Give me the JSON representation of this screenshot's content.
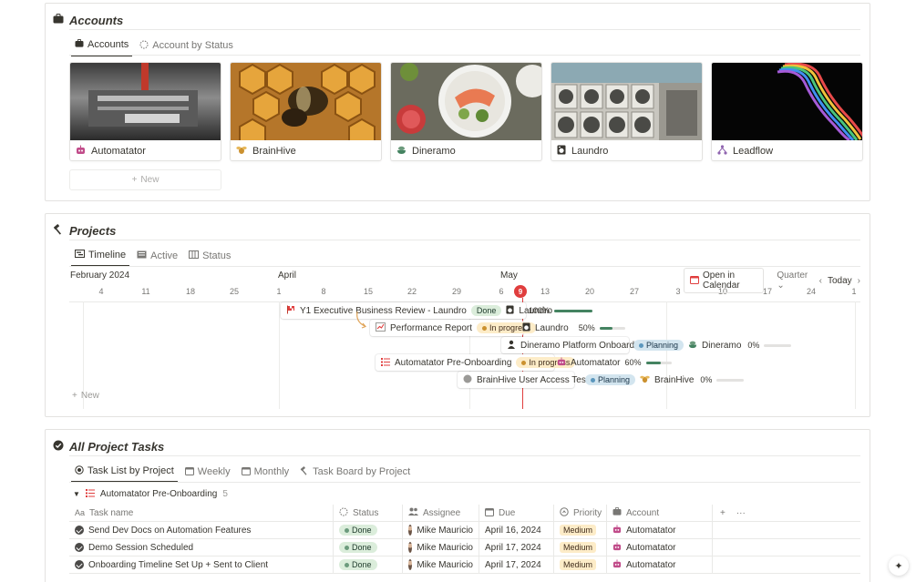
{
  "accounts": {
    "title": "Accounts",
    "tabs": [
      {
        "label": "Accounts",
        "icon": "briefcase-icon"
      },
      {
        "label": "Account by Status",
        "icon": "status-icon"
      }
    ],
    "cards": [
      {
        "name": "Automatator",
        "icon": "robot-icon",
        "color": "#c14c8a"
      },
      {
        "name": "BrainHive",
        "icon": "bee-icon",
        "color": "#cb912f"
      },
      {
        "name": "Dineramo",
        "icon": "leaf-bowl-icon",
        "color": "#448361"
      },
      {
        "name": "Laundro",
        "icon": "washing-machine-icon",
        "color": "#37352f"
      },
      {
        "name": "Leadflow",
        "icon": "flow-icon",
        "color": "#9065b0"
      }
    ],
    "new_label": "New"
  },
  "projects": {
    "title": "Projects",
    "tabs": [
      {
        "label": "Timeline",
        "icon": "timeline-icon"
      },
      {
        "label": "Active",
        "icon": "board-icon"
      },
      {
        "label": "Status",
        "icon": "columns-icon"
      }
    ],
    "months": [
      "February 2024",
      "April",
      "May"
    ],
    "days": [
      "4",
      "11",
      "18",
      "25",
      "1",
      "8",
      "15",
      "22",
      "29",
      "6",
      "9",
      "13",
      "20",
      "27",
      "3",
      "10",
      "17",
      "24",
      "1"
    ],
    "today": "9",
    "controls": {
      "open_calendar": "Open in Calendar",
      "range": "Quarter",
      "today": "Today"
    },
    "rows": [
      {
        "name": "Y1 Executive Business Review - Laundro",
        "status": "Done",
        "account": "Laundro",
        "progress": "100%",
        "fill": 1.0
      },
      {
        "name": "Performance Report",
        "status": "In progress",
        "account": "Laundro",
        "progress": "50%",
        "fill": 0.5
      },
      {
        "name": "Dineramo Platform Onboarding",
        "status": "Planning",
        "account": "Dineramo",
        "progress": "0%",
        "fill": 0.0
      },
      {
        "name": "Automatator Pre-Onboarding",
        "status": "In progress",
        "account": "Automatator",
        "progress": "60%",
        "fill": 0.6
      },
      {
        "name": "BrainHive User Access Testing",
        "status": "Planning",
        "account": "BrainHive",
        "progress": "0%",
        "fill": 0.0
      }
    ],
    "new_label": "New"
  },
  "tasks": {
    "title": "All Project Tasks",
    "tabs": [
      {
        "label": "Task List by Project",
        "icon": "target-icon"
      },
      {
        "label": "Weekly",
        "icon": "calendar-icon"
      },
      {
        "label": "Monthly",
        "icon": "calendar-icon"
      },
      {
        "label": "Task Board by Project",
        "icon": "hammer-icon"
      }
    ],
    "group": {
      "name": "Automatator Pre-Onboarding",
      "count": "5"
    },
    "headers": {
      "name": "Task name",
      "status": "Status",
      "assignee": "Assignee",
      "due": "Due",
      "priority": "Priority",
      "account": "Account"
    },
    "rows": [
      {
        "name": "Send Dev Docs on Automation Features",
        "status": "Done",
        "assignee": "Mike Mauricio",
        "due": "April 16, 2024",
        "priority": "Medium",
        "account": "Automatator"
      },
      {
        "name": "Demo Session Scheduled",
        "status": "Done",
        "assignee": "Mike Mauricio",
        "due": "April 17, 2024",
        "priority": "Medium",
        "account": "Automatator"
      },
      {
        "name": "Onboarding Timeline Set Up + Sent to Client",
        "status": "Done",
        "assignee": "Mike Mauricio",
        "due": "April 17, 2024",
        "priority": "Medium",
        "account": "Automatator"
      }
    ]
  }
}
